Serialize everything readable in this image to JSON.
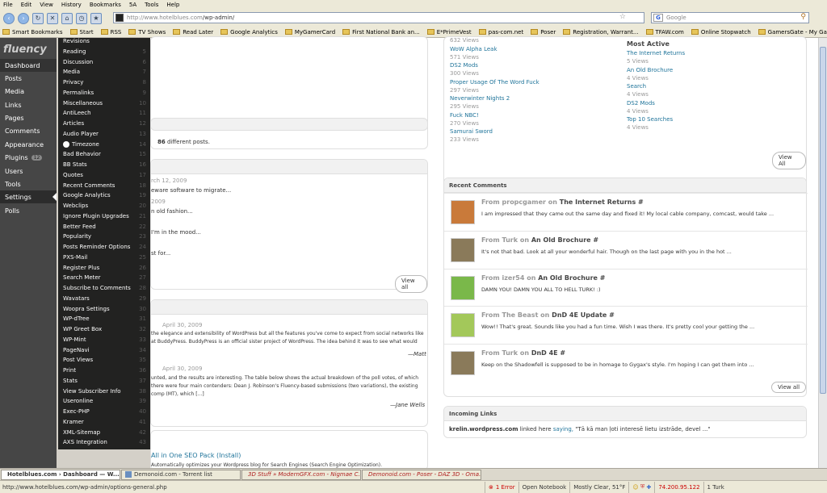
{
  "browser": {
    "menu": [
      "File",
      "Edit",
      "View",
      "History",
      "Bookmarks",
      "5A",
      "Tools",
      "Help"
    ],
    "url_domain": "http://www.hotelblues.com",
    "url_path": "/wp-admin/",
    "search_placeholder": "Google",
    "bookmarks": [
      "Smart Bookmarks",
      "Start",
      "RSS",
      "TV Shows",
      "Read Later",
      "Google Analytics",
      "MyGamerCard",
      "First National Bank an...",
      "E*PrimeVest",
      "pas-com.net",
      "Poser",
      "Registration, Warrant...",
      "TFAW.com",
      "Online Stopwatch",
      "GamersGate - My Ga..."
    ]
  },
  "sidebar": {
    "logo": "fluency",
    "items": [
      {
        "label": "Dashboard"
      },
      {
        "label": "Posts"
      },
      {
        "label": "Media"
      },
      {
        "label": "Links"
      },
      {
        "label": "Pages"
      },
      {
        "label": "Comments"
      },
      {
        "label": "Appearance"
      },
      {
        "label": "Plugins",
        "badge": "12"
      },
      {
        "label": "Users"
      },
      {
        "label": "Tools"
      },
      {
        "label": "Settings"
      },
      {
        "label": "Polls"
      }
    ]
  },
  "flyout": {
    "items": [
      {
        "label": "Revisions",
        "num": ""
      },
      {
        "label": "Reading",
        "num": "5"
      },
      {
        "label": "Discussion",
        "num": "6"
      },
      {
        "label": "Media",
        "num": "7"
      },
      {
        "label": "Privacy",
        "num": "8"
      },
      {
        "label": "Permalinks",
        "num": "9"
      },
      {
        "label": "Miscellaneous",
        "num": "10"
      },
      {
        "label": "AntiLeech",
        "num": "11"
      },
      {
        "label": "Articles",
        "num": "12"
      },
      {
        "label": "Audio Player",
        "num": "13"
      },
      {
        "label": "Timezone",
        "num": "14"
      },
      {
        "label": "Bad Behavior",
        "num": "15"
      },
      {
        "label": "BB Stats",
        "num": "16"
      },
      {
        "label": "Quotes",
        "num": "17"
      },
      {
        "label": "Recent Comments",
        "num": "18"
      },
      {
        "label": "Google Analytics",
        "num": "19"
      },
      {
        "label": "Webclips",
        "num": "20"
      },
      {
        "label": "Ignore Plugin Upgrades",
        "num": "21"
      },
      {
        "label": "Better Feed",
        "num": "22"
      },
      {
        "label": "Popularity",
        "num": "23"
      },
      {
        "label": "Posts Reminder Options",
        "num": "24"
      },
      {
        "label": "PXS-Mail",
        "num": "25"
      },
      {
        "label": "Register Plus",
        "num": "26"
      },
      {
        "label": "Search Meter",
        "num": "27"
      },
      {
        "label": "Subscribe to Comments",
        "num": "28"
      },
      {
        "label": "Wavatars",
        "num": "29"
      },
      {
        "label": "Woopra Settings",
        "num": "30"
      },
      {
        "label": "WP-dTree",
        "num": "31"
      },
      {
        "label": "WP Greet Box",
        "num": "32"
      },
      {
        "label": "WP-Mint",
        "num": "33"
      },
      {
        "label": "PageNavi",
        "num": "34"
      },
      {
        "label": "Post Views",
        "num": "35"
      },
      {
        "label": "Print",
        "num": "36"
      },
      {
        "label": "Stats",
        "num": "37"
      },
      {
        "label": "View Subscriber Info",
        "num": "38"
      },
      {
        "label": "Useronline",
        "num": "39"
      },
      {
        "label": "Exec-PHP",
        "num": "40"
      },
      {
        "label": "Kramer",
        "num": "41"
      },
      {
        "label": "XML-Sitemap",
        "num": "42"
      },
      {
        "label": "AXS Integration",
        "num": "43"
      }
    ]
  },
  "left_col": {
    "stats_text": "86 different posts.",
    "drafts": [
      {
        "date": "rch 12, 2009",
        "text": "eware software to migrate..."
      },
      {
        "date": "2009",
        "text": "n old fashion..."
      },
      {
        "date": "",
        "text": "I'm in the mood..."
      },
      {
        "date": "",
        "text": "st for..."
      }
    ],
    "view_all": "View all",
    "news1_date": "April 30, 2009",
    "news1_l1": "the elegance and extensibility of WordPress but all the features you've come to expect from social networks like",
    "news1_l2": "at BuddyPress. BuddyPress is an official sister project of WordPress. The idea behind it was to see what would",
    "news1_sig": "—Matt",
    "news2_date": "April 30, 2009",
    "news2_l1": "unted, and the results are interesting. The table below shows the actual breakdown of the poll votes, of which",
    "news2_l2": "there were four main contenders: Dean J. Robinson's Fluency-based submissions (two variations), the existing",
    "news2_l3": "comp (MT), which [...]",
    "news2_sig": "—Jane Wells",
    "plugin_title": "All in One SEO Pack (Install)",
    "plugin_desc": "Automatically optimizes your Wordpress blog for Search Engines (Search Engine Optimization)."
  },
  "popular": {
    "items": [
      {
        "title": "",
        "views": "632 Views"
      },
      {
        "title": "WoW Alpha Leak",
        "views": "571 Views"
      },
      {
        "title": "DS2 Mods",
        "views": "300 Views"
      },
      {
        "title": "Proper Usage Of The Word Fuck",
        "views": "297 Views"
      },
      {
        "title": "Neverwinter Nights 2",
        "views": "295 Views"
      },
      {
        "title": "Fuck NBC!",
        "views": "270 Views"
      },
      {
        "title": "Samurai Sword",
        "views": "233 Views"
      }
    ],
    "active_title": "Most Active",
    "active": [
      {
        "title": "The Internet Returns",
        "views": "5 Views"
      },
      {
        "title": "An Old Brochure",
        "views": "4 Views"
      },
      {
        "title": "Search",
        "views": "4 Views"
      },
      {
        "title": "DS2 Mods",
        "views": "4 Views"
      },
      {
        "title": "Top 10 Searches",
        "views": "4 Views"
      }
    ],
    "view_all": "View All"
  },
  "recent_comments": {
    "title": "Recent Comments",
    "items": [
      {
        "from": "From propcgamer on",
        "post": "The Internet Returns #",
        "text": "I am impressed that they came out the same day and fixed it! My local cable company, comcast, would take ..."
      },
      {
        "from": "From Turk on",
        "post": "An Old Brochure #",
        "text": "It's not that bad. Look at all your wonderful hair. Though on the last page with you in the hot ..."
      },
      {
        "from": "From izer54 on",
        "post": "An Old Brochure #",
        "text": "DAMN YOU! DAMN YOU ALL TO HELL TURK! :)"
      },
      {
        "from": "From The Beast on",
        "post": "DnD 4E Update #",
        "text": "Wow!! That's great. Sounds like you had a fun time. Wish I was there. It's pretty cool your getting the ..."
      },
      {
        "from": "From Turk on",
        "post": "DnD 4E #",
        "text": "Keep on the Shadowfell is supposed to be in homage to Gygax's style. I'm hoping I can get them into ..."
      }
    ],
    "view_all": "View all"
  },
  "incoming": {
    "title": "Incoming Links",
    "source": "krelin.wordpress.com",
    "linked": "linked here",
    "saying": "saying,",
    "quote": "\"Tā kā man ļoti interesē lietu izstrāde, devel ...\""
  },
  "taskbar": {
    "tasks": [
      {
        "label": "Hotelblues.com › Dashboard — W..."
      },
      {
        "label": "Demonoid.com - Torrent list"
      },
      {
        "label": "3D Stuff » ModernGFX.com - Nigmae C..."
      },
      {
        "label": "Demonoid.com - Poser - DAZ 3D - Oma..."
      }
    ]
  },
  "statusbar": {
    "url": "http://www.hotelblues.com/wp-admin/options-general.php",
    "error": "1 Error",
    "open_notebook": "Open Notebook",
    "weather": "Mostly Clear, 51°F",
    "ip": "74.200.95.122",
    "user": "1 Turk"
  }
}
